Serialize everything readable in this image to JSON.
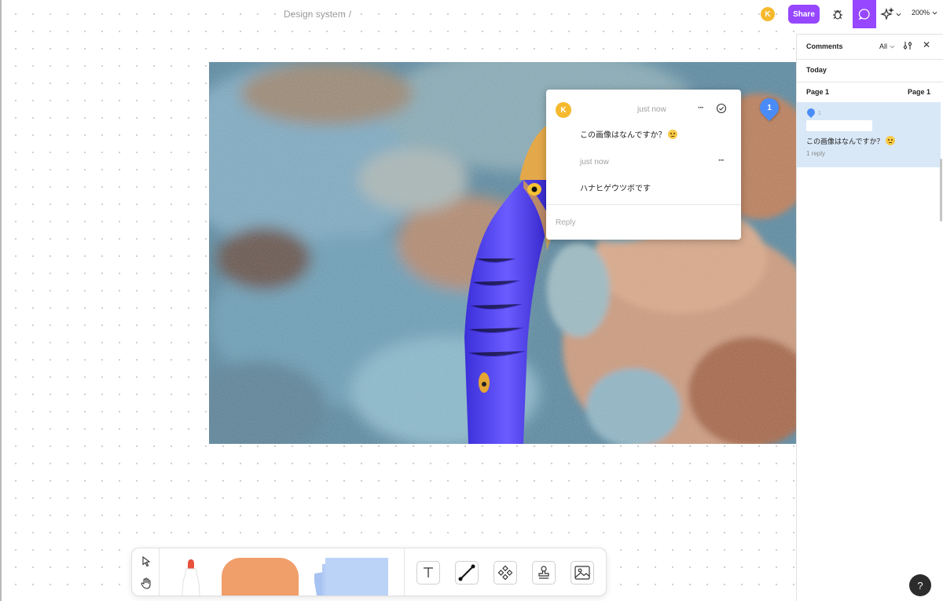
{
  "header": {
    "breadcrumb_file": "Design system",
    "breadcrumb_sep": "/",
    "user_initial": "K",
    "share_label": "Share",
    "zoom_label": "200%"
  },
  "canvas": {
    "pin_number": "1"
  },
  "thread": {
    "author_initial": "K",
    "first_timestamp": "just now",
    "first_message": "この画像はなんですか？",
    "second_timestamp": "just now",
    "second_message": "ハナヒゲウツボです",
    "reply_placeholder": "Reply",
    "more_label": "···"
  },
  "comments_panel": {
    "title": "Comments",
    "filter_label": "All",
    "section_today": "Today",
    "page_left": "Page 1",
    "page_right": "Page 1",
    "item": {
      "pin_number": "1",
      "message": "この画像はなんですか？",
      "replies": "1 reply"
    }
  },
  "help": {
    "label": "?"
  },
  "colors": {
    "accent": "#9747ff",
    "avatar": "#f5b92d",
    "pin": "#4a8cf7",
    "selected_row": "#d9e8f7",
    "shape": "#f09e6a",
    "sticky": "#b8cff7",
    "marker": "#e8503a"
  },
  "icons": {
    "bug": "bug-icon",
    "comment": "comment-icon",
    "ai": "sparkle-icon",
    "resolve": "check-circle-icon",
    "settings": "sliders-icon",
    "close": "close-icon",
    "select": "cursor-arrow-icon",
    "hand": "hand-icon",
    "text": "text-icon",
    "connector": "connector-icon",
    "component": "component-icon",
    "stamp": "stamp-icon",
    "image": "image-icon"
  }
}
